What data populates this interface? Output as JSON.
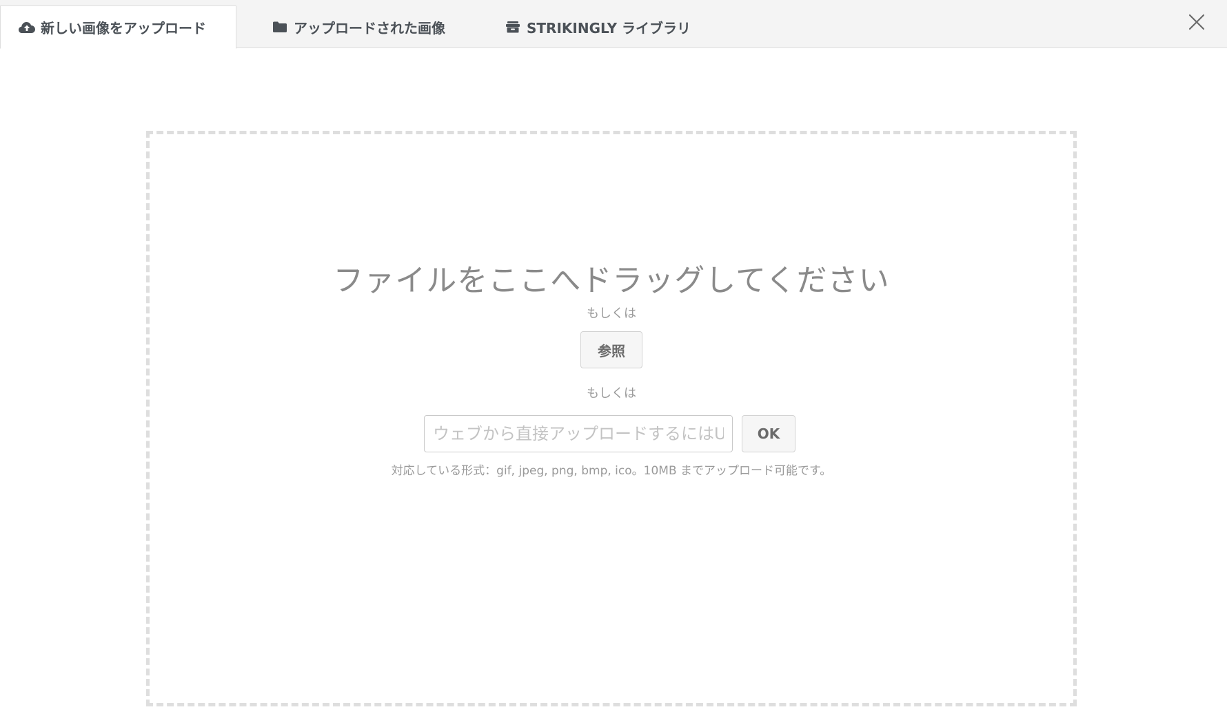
{
  "tabs": [
    {
      "label": "新しい画像をアップロード",
      "icon": "cloud-upload-icon",
      "active": true
    },
    {
      "label": "アップロードされた画像",
      "icon": "folder-icon",
      "active": false
    },
    {
      "label": "STRIKINGLY ライブラリ",
      "icon": "archive-icon",
      "active": false
    }
  ],
  "close": {
    "icon": "close-icon"
  },
  "dropzone": {
    "title": "ファイルをここへドラッグしてください",
    "or_text_1": "もしくは",
    "browse_label": "参照",
    "or_text_2": "もしくは",
    "url_placeholder": "ウェブから直接アップロードするにはU",
    "url_value": "",
    "ok_label": "OK",
    "formats_text": "対応している形式：gif, jpeg, png, bmp, ico。10MB までアップロード可能です。"
  },
  "colors": {
    "tabbar_bg": "#f4f4f4",
    "tab_text": "#4b5157",
    "dashed_border": "#dedede",
    "muted_text": "#9a9a9a"
  }
}
